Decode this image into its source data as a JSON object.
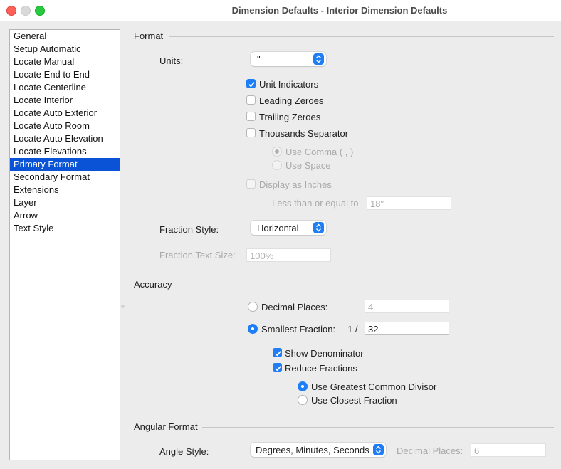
{
  "window": {
    "title": "Dimension Defaults - Interior Dimension Defaults"
  },
  "sidebar": {
    "items": [
      {
        "label": "General",
        "selected": false
      },
      {
        "label": "Setup Automatic",
        "selected": false
      },
      {
        "label": "Locate Manual",
        "selected": false
      },
      {
        "label": "Locate End to End",
        "selected": false
      },
      {
        "label": "Locate Centerline",
        "selected": false
      },
      {
        "label": "Locate Interior",
        "selected": false
      },
      {
        "label": "Locate Auto Exterior",
        "selected": false
      },
      {
        "label": "Locate Auto Room",
        "selected": false
      },
      {
        "label": "Locate Auto Elevation",
        "selected": false
      },
      {
        "label": "Locate Elevations",
        "selected": false
      },
      {
        "label": "Primary Format",
        "selected": true
      },
      {
        "label": "Secondary Format",
        "selected": false
      },
      {
        "label": "Extensions",
        "selected": false
      },
      {
        "label": "Layer",
        "selected": false
      },
      {
        "label": "Arrow",
        "selected": false
      },
      {
        "label": "Text Style",
        "selected": false
      }
    ]
  },
  "format": {
    "section_label": "Format",
    "units_label": "Units:",
    "units_value": "\"",
    "unit_indicators": {
      "label": "Unit Indicators",
      "checked": true
    },
    "leading_zeroes": {
      "label": "Leading Zeroes",
      "checked": false
    },
    "trailing_zeroes": {
      "label": "Trailing Zeroes",
      "checked": false
    },
    "thousands_separator": {
      "label": "Thousands Separator",
      "checked": false
    },
    "use_comma": {
      "label": "Use Comma ( , )",
      "selected": true,
      "enabled": false
    },
    "use_space": {
      "label": "Use Space",
      "selected": false,
      "enabled": false
    },
    "display_as_inches": {
      "label": "Display as Inches",
      "checked": false,
      "enabled": false
    },
    "less_than_label": "Less than or equal to",
    "less_than_value": "18\"",
    "fraction_style_label": "Fraction Style:",
    "fraction_style_value": "Horizontal",
    "fraction_text_size_label": "Fraction Text Size:",
    "fraction_text_size_value": "100%"
  },
  "accuracy": {
    "section_label": "Accuracy",
    "decimal_places": {
      "label": "Decimal Places:",
      "selected": false,
      "value": "4"
    },
    "smallest_fraction": {
      "label": "Smallest Fraction:",
      "selected": true,
      "prefix": "1 /",
      "value": "32"
    },
    "show_denominator": {
      "label": "Show Denominator",
      "checked": true
    },
    "reduce_fractions": {
      "label": "Reduce Fractions",
      "checked": true
    },
    "use_gcd": {
      "label": "Use Greatest Common Divisor",
      "selected": true
    },
    "use_closest": {
      "label": "Use Closest Fraction",
      "selected": false
    }
  },
  "angular": {
    "section_label": "Angular Format",
    "angle_style_label": "Angle Style:",
    "angle_style_value": "Degrees, Minutes, Seconds",
    "decimal_places_label": "Decimal Places:",
    "decimal_places_value": "6"
  },
  "colors": {
    "accent": "#1f7ef6",
    "selection": "#0a52d6"
  }
}
